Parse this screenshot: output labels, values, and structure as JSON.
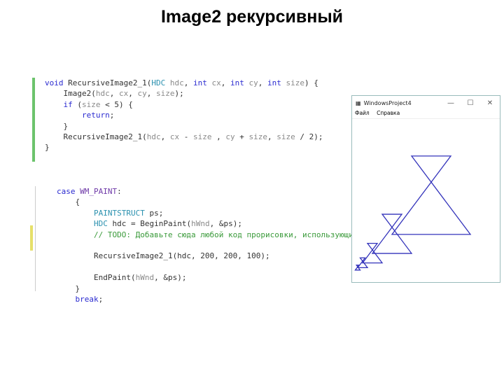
{
  "title": "Image2 рекурсивный",
  "code_block_1": [
    [
      [
        "void ",
        "kw"
      ],
      [
        "RecursiveImage2_1(",
        "fn"
      ],
      [
        "HDC ",
        "ty"
      ],
      [
        "hdc",
        "pm"
      ],
      [
        ", ",
        "fn"
      ],
      [
        "int ",
        "kw"
      ],
      [
        "cx",
        "pm"
      ],
      [
        ", ",
        "fn"
      ],
      [
        "int ",
        "kw"
      ],
      [
        "cy",
        "pm"
      ],
      [
        ", ",
        "fn"
      ],
      [
        "int ",
        "kw"
      ],
      [
        "size",
        "pm"
      ],
      [
        ") {",
        "fn"
      ]
    ],
    [
      [
        "    Image2(",
        "fn"
      ],
      [
        "hdc",
        "pm"
      ],
      [
        ", ",
        "fn"
      ],
      [
        "cx",
        "pm"
      ],
      [
        ", ",
        "fn"
      ],
      [
        "cy",
        "pm"
      ],
      [
        ", ",
        "fn"
      ],
      [
        "size",
        "pm"
      ],
      [
        ");",
        "fn"
      ]
    ],
    [
      [
        "    ",
        "fn"
      ],
      [
        "if ",
        "kw"
      ],
      [
        "(",
        "fn"
      ],
      [
        "size",
        "pm"
      ],
      [
        " < 5) {",
        "fn"
      ]
    ],
    [
      [
        "        ",
        "fn"
      ],
      [
        "return",
        "kw"
      ],
      [
        ";",
        "fn"
      ]
    ],
    [
      [
        "    }",
        "fn"
      ]
    ],
    [
      [
        "    RecursiveImage2_1(",
        "fn"
      ],
      [
        "hdc",
        "pm"
      ],
      [
        ", ",
        "fn"
      ],
      [
        "cx",
        "pm"
      ],
      [
        " - ",
        "fn"
      ],
      [
        "size",
        "pm"
      ],
      [
        " , ",
        "fn"
      ],
      [
        "cy",
        "pm"
      ],
      [
        " + ",
        "fn"
      ],
      [
        "size",
        "pm"
      ],
      [
        ", ",
        "fn"
      ],
      [
        "size",
        "pm"
      ],
      [
        " / 2);",
        "fn"
      ]
    ],
    [
      [
        "}",
        "fn"
      ]
    ]
  ],
  "code_block_2": [
    [
      [
        "case ",
        "kw"
      ],
      [
        "WM_PAINT",
        "mc"
      ],
      [
        ":",
        "fn"
      ]
    ],
    [
      [
        "    {",
        "fn"
      ]
    ],
    [
      [
        "        ",
        "fn"
      ],
      [
        "PAINTSTRUCT ",
        "ty"
      ],
      [
        "ps;",
        "fn"
      ]
    ],
    [
      [
        "        ",
        "fn"
      ],
      [
        "HDC ",
        "ty"
      ],
      [
        "hdc = BeginPaint(",
        "fn"
      ],
      [
        "hWnd",
        "pm"
      ],
      [
        ", &ps);",
        "fn"
      ]
    ],
    [
      [
        "        ",
        "fn"
      ],
      [
        "// TODO: Добавьте сюда любой код прорисовки, использующий HDC...",
        "cm"
      ]
    ],
    [
      [
        "",
        "fn"
      ]
    ],
    [
      [
        "        RecursiveImage2_1(hdc, 200, 200, 100);",
        "fn"
      ]
    ],
    [
      [
        "",
        "fn"
      ]
    ],
    [
      [
        "        EndPaint(",
        "fn"
      ],
      [
        "hWnd",
        "pm"
      ],
      [
        ", &ps);",
        "fn"
      ]
    ],
    [
      [
        "    }",
        "fn"
      ]
    ],
    [
      [
        "    ",
        "fn"
      ],
      [
        "break",
        "kw"
      ],
      [
        ";",
        "fn"
      ]
    ]
  ],
  "window": {
    "title": "WindowsProject4",
    "menu": [
      "Файл",
      "Справка"
    ],
    "minimize": "—",
    "maximize": "☐",
    "close": "✕",
    "figure_color": "#3333bb"
  }
}
